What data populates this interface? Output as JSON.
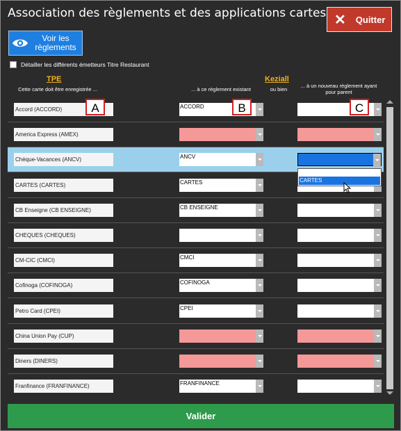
{
  "window": {
    "title": "Association des règlements et des applications cartes du TPE"
  },
  "quit_button": {
    "label": "Quitter"
  },
  "view_button": {
    "label": "Voir les\nrèglements"
  },
  "detail_checkbox": {
    "label": "Détailler les différents émetteurs Titre Restaurant",
    "checked": false
  },
  "headers": {
    "tpe": "TPE",
    "tpe_sub": "Cette carte doit être enregistrée ...",
    "existing_sub": "... à ce règlement existant",
    "keziall": "Keziall",
    "or": "ou bien",
    "new_sub": "... à un nouveau règlement ayant pour parent"
  },
  "markers": [
    "A",
    "B",
    "C"
  ],
  "rows": [
    {
      "name": "Accord (ACCORD)",
      "existing": "ACCORD",
      "existing_state": "white",
      "new": "",
      "new_state": "white"
    },
    {
      "name": "America Express (AMEX)",
      "existing": "",
      "existing_state": "pink",
      "new": "",
      "new_state": "pink"
    },
    {
      "name": "Chèque-Vacances (ANCV)",
      "existing": "ANCV",
      "existing_state": "white",
      "new": "",
      "new_state": "blue"
    },
    {
      "name": "CARTES (CARTES)",
      "existing": "CARTES",
      "existing_state": "white",
      "new": "",
      "new_state": "white"
    },
    {
      "name": "CB Enseigne (CB ENSEIGNE)",
      "existing": "CB ENSEIGNE",
      "existing_state": "white",
      "new": "",
      "new_state": "white"
    },
    {
      "name": "CHEQUES (CHEQUES)",
      "existing": "",
      "existing_state": "white",
      "new": "",
      "new_state": "white"
    },
    {
      "name": "CM-CIC (CMCI)",
      "existing": "CMCI",
      "existing_state": "white",
      "new": "",
      "new_state": "white"
    },
    {
      "name": "Cofinoga (COFINOGA)",
      "existing": "COFINOGA",
      "existing_state": "white",
      "new": "",
      "new_state": "white"
    },
    {
      "name": "Petro Card (CPEI)",
      "existing": "CPEI",
      "existing_state": "white",
      "new": "",
      "new_state": "white"
    },
    {
      "name": "China Union Pay (CUP)",
      "existing": "",
      "existing_state": "pink",
      "new": "",
      "new_state": "pink"
    },
    {
      "name": "Diners (DINERS)",
      "existing": "",
      "existing_state": "pink",
      "new": "",
      "new_state": "pink"
    },
    {
      "name": "Franfinance (FRANFINANCE)",
      "existing": "FRANFINANCE",
      "existing_state": "white",
      "new": "",
      "new_state": "white"
    }
  ],
  "highlight_row": 2,
  "dropdown": {
    "option": "CARTES"
  },
  "validate_button": {
    "label": "Valider"
  },
  "colors": {
    "background": "#2b2b2b",
    "quit": "#c0392b",
    "view": "#1f7fe0",
    "header_gold": "#f0b020",
    "missing_pink": "#f59898",
    "selected_blue": "#1a74e0",
    "row_highlight": "#9bd0ec",
    "validate_green": "#2e9a4b"
  }
}
